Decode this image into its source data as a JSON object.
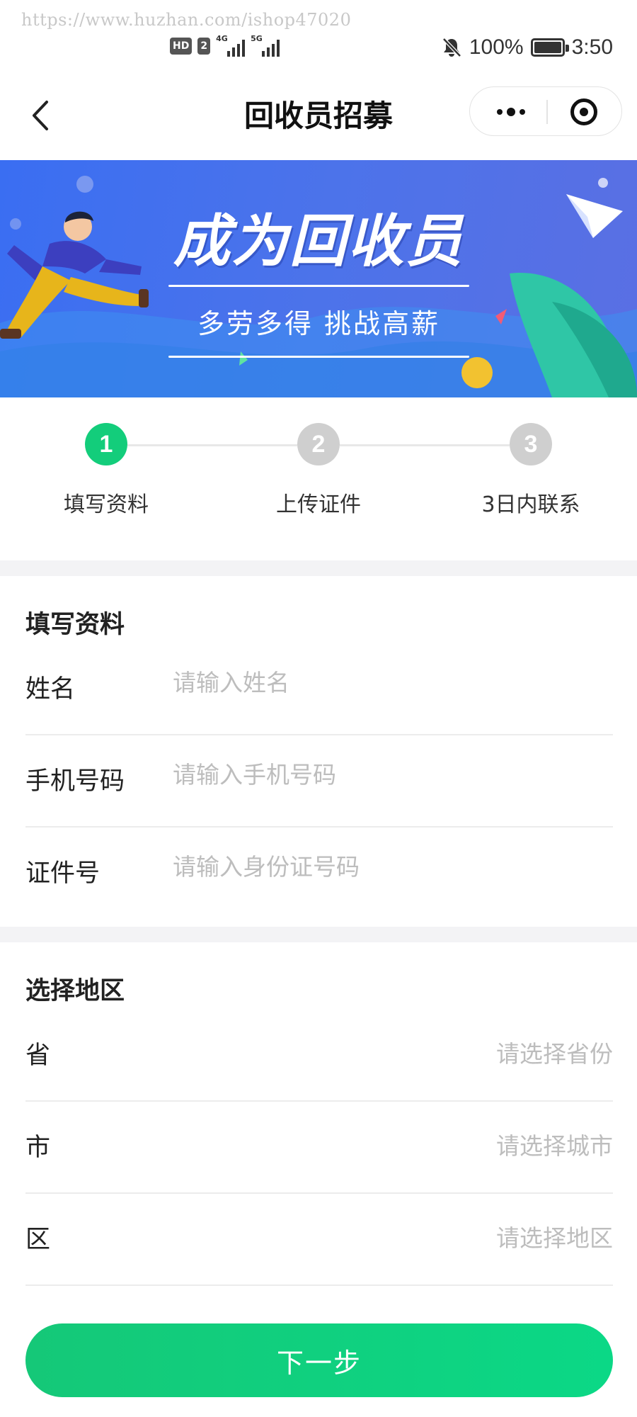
{
  "status_bar": {
    "watermark": "https://www.huzhan.com/ishop47020",
    "hd_label": "HD",
    "sim_number": "2",
    "network_1": "4G",
    "network_2": "5G",
    "battery_text": "100%",
    "battery_level": 1.0,
    "time": "3:50",
    "icons": [
      "bell-muted-icon",
      "signal-icon",
      "battery-icon"
    ]
  },
  "nav": {
    "title": "回收员招募",
    "back_icon": "chevron-left-icon",
    "more_icon": "more-icon",
    "close_icon": "target-icon"
  },
  "banner": {
    "title": "成为回收员",
    "subtitle": "多劳多得 挑战高薪"
  },
  "steps": [
    {
      "number": "1",
      "label": "填写资料",
      "active": true
    },
    {
      "number": "2",
      "label": "上传证件",
      "active": false
    },
    {
      "number": "3",
      "label": "3日内联系",
      "active": false
    }
  ],
  "info_section": {
    "title": "填写资料",
    "fields": [
      {
        "label": "姓名",
        "placeholder": "请输入姓名",
        "value": ""
      },
      {
        "label": "手机号码",
        "placeholder": "请输入手机号码",
        "value": ""
      },
      {
        "label": "证件号",
        "placeholder": "请输入身份证号码",
        "value": ""
      }
    ]
  },
  "region_section": {
    "title": "选择地区",
    "fields": [
      {
        "label": "省",
        "placeholder": "请选择省份"
      },
      {
        "label": "市",
        "placeholder": "请选择城市"
      },
      {
        "label": "区",
        "placeholder": "请选择地区"
      }
    ]
  },
  "next_button": "下一步",
  "colors": {
    "accent": "#13cd7b",
    "banner_blue": "#4c73ea",
    "inactive_step": "#cfcfcf",
    "placeholder": "#bdbdbd",
    "divider_band": "#f3f3f5"
  }
}
